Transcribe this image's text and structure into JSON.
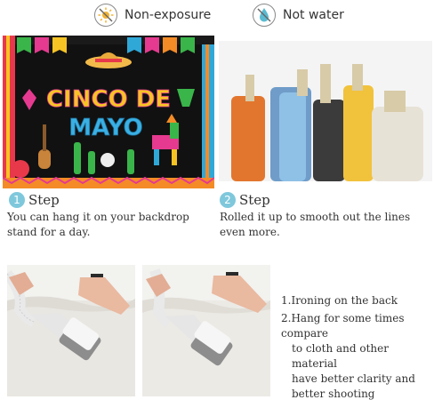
{
  "badges": {
    "non_exposure": {
      "label": "Non-exposure",
      "icon": "sun-crossed-icon"
    },
    "not_water": {
      "label": "Not water",
      "icon": "water-drop-crossed-icon"
    }
  },
  "banner": {
    "line1": "CINCO DE",
    "line2": "MAYO"
  },
  "steps": [
    {
      "number": "1",
      "title": "Step",
      "line1": "You can hang it on your backdrop",
      "line2": "stand for a day."
    },
    {
      "number": "2",
      "title": "Step",
      "line1": "Rolled it up to smooth out the lines",
      "line2": "even more."
    }
  ],
  "notes": {
    "item1": "1.Ironing on the back",
    "item2_line1": "2.Hang for some times compare",
    "item2_line2": "to cloth and other material",
    "item2_line3": "have better clarity and",
    "item2_line4": "better shooting"
  },
  "colors": {
    "step_circle": "#7fc8dc",
    "banner_bg": "#111111",
    "text": "#333333"
  }
}
